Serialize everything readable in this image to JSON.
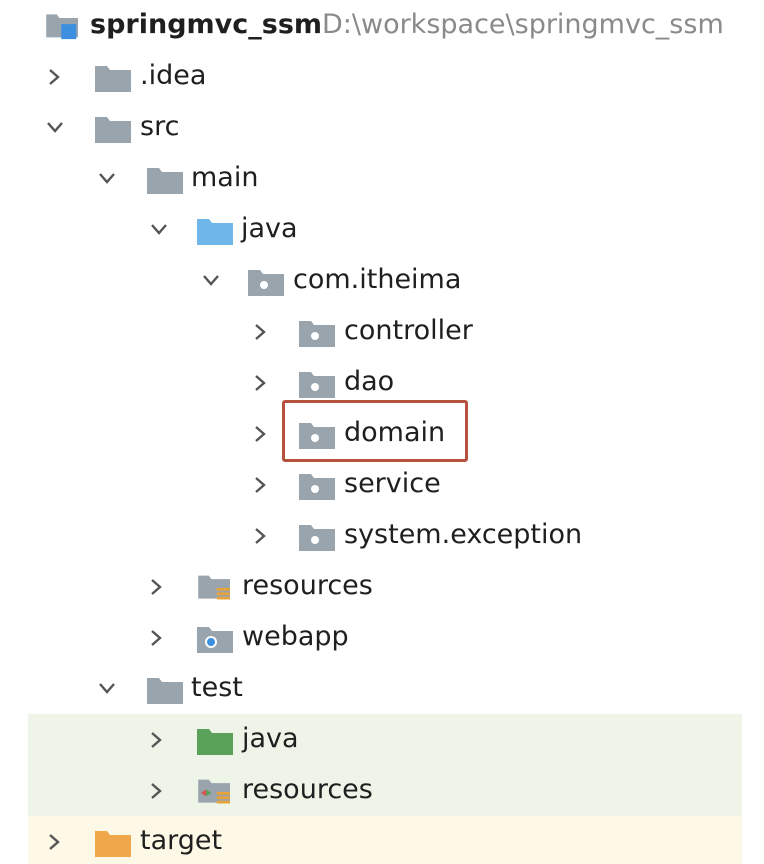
{
  "project": {
    "name": "springmvc_ssm",
    "path": "D:\\workspace\\springmvc_ssm"
  },
  "nodes": [
    {
      "key": "idea",
      "label": ".idea",
      "expanded": false,
      "icon": "folder-icon"
    },
    {
      "key": "src",
      "label": "src",
      "expanded": true,
      "icon": "folder-icon"
    },
    {
      "key": "main",
      "label": "main",
      "expanded": true,
      "icon": "folder-icon"
    },
    {
      "key": "java",
      "label": "java",
      "expanded": true,
      "icon": "source-root-folder-icon"
    },
    {
      "key": "com-itheima",
      "label": "com.itheima",
      "expanded": true,
      "icon": "package-icon"
    },
    {
      "key": "controller",
      "label": "controller",
      "expanded": false,
      "icon": "package-icon"
    },
    {
      "key": "dao",
      "label": "dao",
      "expanded": false,
      "icon": "package-icon"
    },
    {
      "key": "domain",
      "label": "domain",
      "expanded": false,
      "icon": "package-icon",
      "highlighted": true
    },
    {
      "key": "service",
      "label": "service",
      "expanded": false,
      "icon": "package-icon"
    },
    {
      "key": "system-exception",
      "label": "system.exception",
      "expanded": false,
      "icon": "package-icon"
    },
    {
      "key": "resources",
      "label": "resources",
      "expanded": false,
      "icon": "resources-root-folder-icon"
    },
    {
      "key": "webapp",
      "label": "webapp",
      "expanded": false,
      "icon": "web-folder-icon"
    },
    {
      "key": "test",
      "label": "test",
      "expanded": true,
      "icon": "folder-icon"
    },
    {
      "key": "test-java",
      "label": "java",
      "expanded": false,
      "icon": "test-source-root-folder-icon"
    },
    {
      "key": "test-resources",
      "label": "resources",
      "expanded": false,
      "icon": "test-resources-root-folder-icon"
    },
    {
      "key": "target",
      "label": "target",
      "expanded": false,
      "icon": "excluded-folder-icon"
    }
  ],
  "colors": {
    "folder": "#9aa4ad",
    "source_root": "#6fb7e8",
    "test_root": "#5aa25a",
    "excluded": "#f0a64a",
    "highlight_border": "#b5513e",
    "test_row_bg": "#eef5e8",
    "target_row_bg": "#fdf9e6"
  }
}
